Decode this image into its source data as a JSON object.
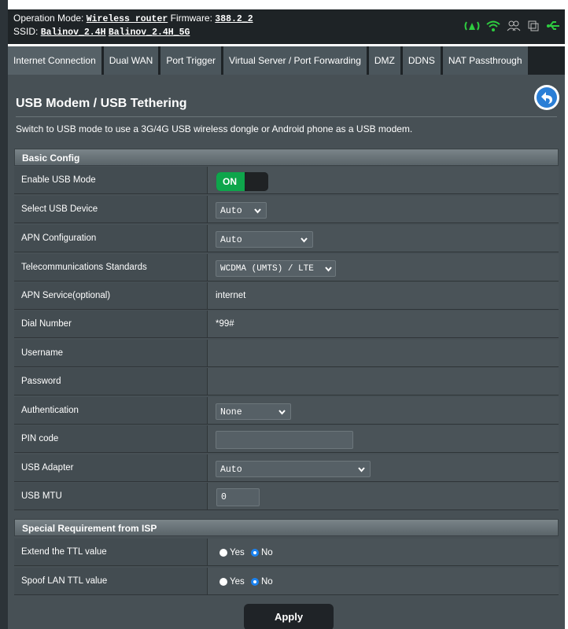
{
  "header": {
    "op_mode_label": "Operation Mode:",
    "op_mode_value": "Wireless router",
    "firmware_label": "Firmware:",
    "firmware_value": "388.2_2",
    "ssid_label": "SSID:",
    "ssid_1": "Balinov_2.4H",
    "ssid_2": "Balinov_2.4H_5G",
    "icons": [
      "usb-signal-icon",
      "wifi-icon",
      "users-icon",
      "copy-icon",
      "usb-connection-icon"
    ],
    "accent_green": "#2ecc40"
  },
  "tabs": [
    {
      "label": "Internet Connection",
      "active": true
    },
    {
      "label": "Dual WAN",
      "active": false
    },
    {
      "label": "Port Trigger",
      "active": false
    },
    {
      "label": "Virtual Server / Port Forwarding",
      "active": false
    },
    {
      "label": "DMZ",
      "active": false
    },
    {
      "label": "DDNS",
      "active": false
    },
    {
      "label": "NAT Passthrough",
      "active": false
    }
  ],
  "page": {
    "title": "USB Modem / USB Tethering",
    "description": "Switch to USB mode to use a 3G/4G USB wireless dongle or Android phone as a USB modem."
  },
  "basic_config": {
    "header": "Basic Config",
    "enable_usb_mode": {
      "label": "Enable USB Mode",
      "value": "ON"
    },
    "select_usb_device": {
      "label": "Select USB Device",
      "value": "Auto"
    },
    "apn_configuration": {
      "label": "APN Configuration",
      "value": "Auto"
    },
    "telecom_standards": {
      "label": "Telecommunications Standards",
      "value": "WCDMA (UMTS) / LTE"
    },
    "apn_service": {
      "label": "APN Service(optional)",
      "value": "internet"
    },
    "dial_number": {
      "label": "Dial Number",
      "value": "*99#"
    },
    "username": {
      "label": "Username",
      "value": ""
    },
    "password": {
      "label": "Password",
      "value": ""
    },
    "authentication": {
      "label": "Authentication",
      "value": "None"
    },
    "pin_code": {
      "label": "PIN code",
      "value": ""
    },
    "usb_adapter": {
      "label": "USB Adapter",
      "value": "Auto"
    },
    "usb_mtu": {
      "label": "USB MTU",
      "value": "0"
    }
  },
  "special": {
    "header": "Special Requirement from ISP",
    "extend_ttl": {
      "label": "Extend the TTL value",
      "yes": "Yes",
      "no": "No",
      "selected": "No"
    },
    "spoof_ttl": {
      "label": "Spoof LAN TTL value",
      "yes": "Yes",
      "no": "No",
      "selected": "No"
    }
  },
  "apply_label": "Apply",
  "colors": {
    "toggle_on": "#0ea54b",
    "radio_selected": "#1a82f0",
    "back_button": "#2b7fd6"
  }
}
